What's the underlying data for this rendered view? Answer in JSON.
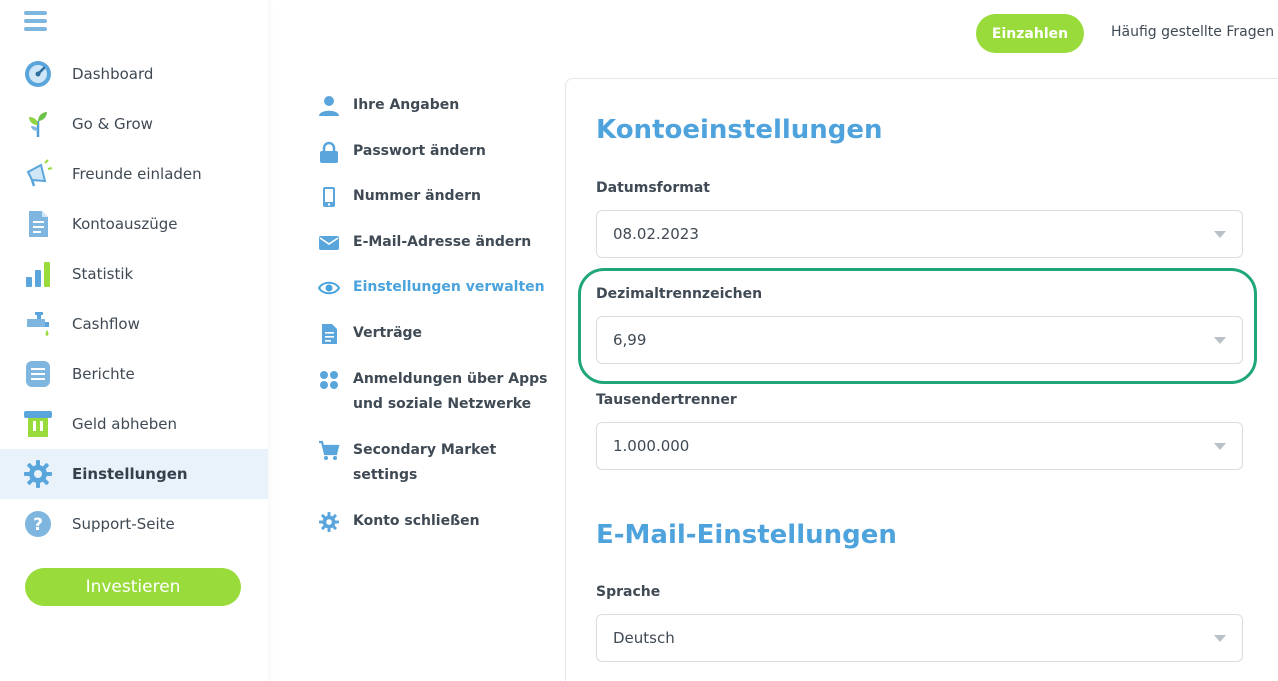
{
  "header": {
    "deposit_label": "Einzahlen",
    "faq_label": "Häufig gestellte Fragen"
  },
  "sidebar": {
    "items": [
      {
        "label": "Dashboard",
        "icon": "dashboard-gauge-icon"
      },
      {
        "label": "Go & Grow",
        "icon": "plant-sprout-icon"
      },
      {
        "label": "Freunde einladen",
        "icon": "megaphone-icon"
      },
      {
        "label": "Kontoauszüge",
        "icon": "document-icon"
      },
      {
        "label": "Statistik",
        "icon": "bar-chart-icon"
      },
      {
        "label": "Cashflow",
        "icon": "tap-icon"
      },
      {
        "label": "Berichte",
        "icon": "report-list-icon"
      },
      {
        "label": "Geld abheben",
        "icon": "atm-withdraw-icon"
      },
      {
        "label": "Einstellungen",
        "icon": "gear-icon",
        "active": true
      },
      {
        "label": "Support-Seite",
        "icon": "question-icon"
      }
    ],
    "invest_label": "Investieren"
  },
  "submenu": {
    "items": [
      {
        "line1": "Ihre Angaben",
        "line2": "",
        "icon": "user-icon"
      },
      {
        "line1": "Passwort ändern",
        "line2": "",
        "icon": "lock-icon"
      },
      {
        "line1": "Nummer ändern",
        "line2": "",
        "icon": "phone-icon"
      },
      {
        "line1": "E-Mail-Adresse ändern",
        "line2": "",
        "icon": "envelope-icon"
      },
      {
        "line1": "Einstellungen verwalten",
        "line2": "",
        "icon": "eye-icon",
        "active": true
      },
      {
        "line1": "Verträge",
        "line2": "",
        "icon": "contract-icon"
      },
      {
        "line1": "Anmeldungen über Apps",
        "line2": "und soziale Netzwerke",
        "icon": "apps-grid-icon"
      },
      {
        "line1": "Secondary Market",
        "line2": "settings",
        "icon": "cart-icon"
      },
      {
        "line1": "Konto schließen",
        "line2": "",
        "icon": "gear-small-icon"
      }
    ]
  },
  "account_settings": {
    "title": "Kontoeinstellungen",
    "date_format": {
      "label": "Datumsformat",
      "value": "08.02.2023"
    },
    "decimal_separator": {
      "label": "Dezimaltrennzeichen",
      "value": "6,99"
    },
    "thousands_separator": {
      "label": "Tausendertrenner",
      "value": "1.000.000"
    }
  },
  "email_settings": {
    "title": "E-Mail-Einstellungen",
    "language": {
      "label": "Sprache",
      "value": "Deutsch"
    }
  },
  "colors": {
    "accent_green": "#98db3b",
    "title_blue": "#4fa3dd",
    "highlight_teal": "#1fa67a"
  }
}
